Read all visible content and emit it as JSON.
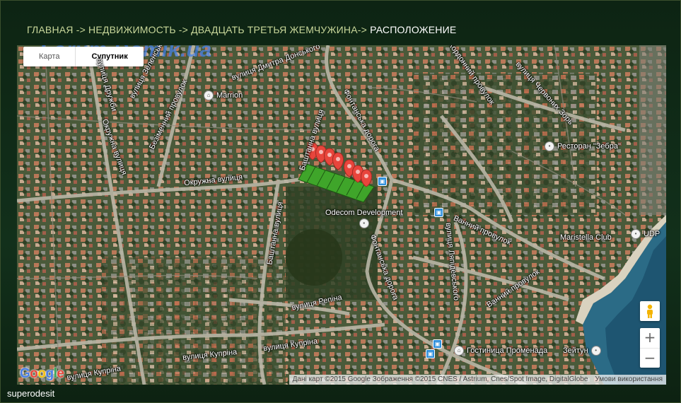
{
  "breadcrumb": {
    "items": [
      "ГЛАВНАЯ",
      "НЕДВИЖИМОСТЬ",
      "ДВАДЦАТЬ ТРЕТЬЯ ЖЕМЧУЖИНА"
    ],
    "separators": [
      " -> ",
      " -> ",
      "-> "
    ],
    "current": "РАСПОЛОЖЕНИЕ"
  },
  "map": {
    "type_buttons": [
      "Карта",
      "Супутник"
    ],
    "active_type": "Супутник",
    "watermark": "Forum.Domik.ua",
    "streets": [
      "вулиця Дмитра Донського",
      "вулиця Зеленсько",
      "Безіменний провулок",
      "вулиця Дружби",
      "Окружна вулиця",
      "Окружна вулиця",
      "Баштанна вулиця",
      "Баштанна вулиця",
      "Фонтанська дорога",
      "Фонтанська дорога",
      "Кордонний провулок",
      "вулиця Червоних Зорь",
      "Ванний провулок",
      "Ванний провулок",
      "вулиця Ляпідевського",
      "вулиця Репіна",
      "вулиця Купріна",
      "вулиця Купріна",
      "вулиця Купріна"
    ],
    "pois": [
      "Marrion",
      "Ресторан \"Зебра\"",
      "Odecom Development",
      "Maristella Club",
      "UDP",
      "Гостиница Променада",
      "Зейтун"
    ],
    "zoom_in": "+",
    "zoom_out": "−",
    "google_logo": "Google",
    "attribution": "Дані карт ©2015 Google Зображення ©2015 CNES / Astrium, Cnes/Spot Image, DigitalGlobe",
    "terms": "Умови використання",
    "colors": {
      "marker": "#e8453c",
      "parcel": "#3fa52a"
    }
  },
  "user": {
    "name": "superodesit"
  }
}
